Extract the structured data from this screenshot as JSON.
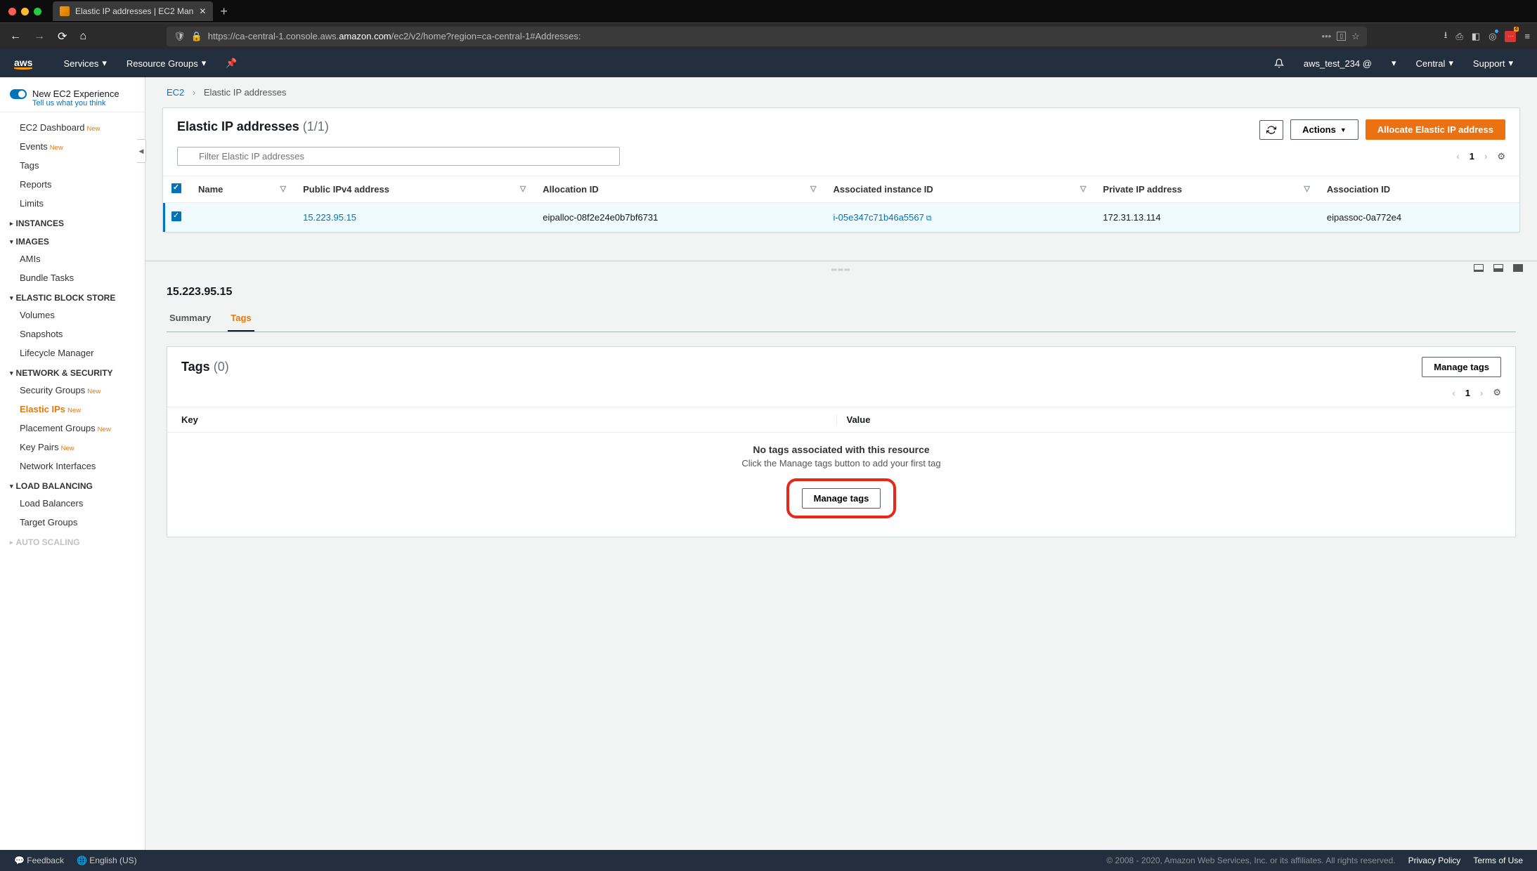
{
  "browser": {
    "tab_title": "Elastic IP addresses | EC2 Man",
    "url_prefix": "https://ca-central-1.console.aws.",
    "url_bold": "amazon.com",
    "url_suffix": "/ec2/v2/home?region=ca-central-1#Addresses:"
  },
  "header": {
    "logo": "aws",
    "services": "Services",
    "resource_groups": "Resource Groups",
    "user": "aws_test_234 @",
    "region": "Central",
    "support": "Support"
  },
  "sidebar": {
    "toggle_label": "New EC2 Experience",
    "toggle_sub": "Tell us what you think",
    "items_top": [
      {
        "label": "EC2 Dashboard",
        "new": true
      },
      {
        "label": "Events",
        "new": true
      },
      {
        "label": "Tags",
        "new": false
      },
      {
        "label": "Reports",
        "new": false
      },
      {
        "label": "Limits",
        "new": false
      }
    ],
    "sec_instances": "INSTANCES",
    "sec_images": "IMAGES",
    "images_items": [
      {
        "label": "AMIs"
      },
      {
        "label": "Bundle Tasks"
      }
    ],
    "sec_ebs": "ELASTIC BLOCK STORE",
    "ebs_items": [
      {
        "label": "Volumes"
      },
      {
        "label": "Snapshots"
      },
      {
        "label": "Lifecycle Manager"
      }
    ],
    "sec_net": "NETWORK & SECURITY",
    "net_items": [
      {
        "label": "Security Groups",
        "new": true,
        "active": false
      },
      {
        "label": "Elastic IPs",
        "new": true,
        "active": true
      },
      {
        "label": "Placement Groups",
        "new": true,
        "active": false
      },
      {
        "label": "Key Pairs",
        "new": true,
        "active": false
      },
      {
        "label": "Network Interfaces",
        "new": false,
        "active": false
      }
    ],
    "sec_lb": "LOAD BALANCING",
    "lb_items": [
      {
        "label": "Load Balancers"
      },
      {
        "label": "Target Groups"
      }
    ],
    "sec_auto": "AUTO SCALING"
  },
  "breadcrumb": {
    "root": "EC2",
    "current": "Elastic IP addresses"
  },
  "eip_panel": {
    "title": "Elastic IP addresses",
    "count": "(1/1)",
    "filter_placeholder": "Filter Elastic IP addresses",
    "actions": "Actions",
    "allocate": "Allocate Elastic IP address",
    "page": "1",
    "cols": {
      "name": "Name",
      "public_ip": "Public IPv4 address",
      "alloc_id": "Allocation ID",
      "assoc_inst": "Associated instance ID",
      "priv_ip": "Private IP address",
      "assoc_id": "Association ID"
    },
    "row": {
      "name": "",
      "public_ip": "15.223.95.15",
      "alloc_id": "eipalloc-08f2e24e0b7bf6731",
      "assoc_inst": "i-05e347c71b46a5567",
      "priv_ip": "172.31.13.114",
      "assoc_id": "eipassoc-0a772e4"
    }
  },
  "detail": {
    "title": "15.223.95.15",
    "tab_summary": "Summary",
    "tab_tags": "Tags",
    "tags_title": "Tags",
    "tags_count": "(0)",
    "manage_tags": "Manage tags",
    "page": "1",
    "col_key": "Key",
    "col_value": "Value",
    "empty_strong": "No tags associated with this resource",
    "empty_sub": "Click the Manage tags button to add your first tag"
  },
  "footer": {
    "feedback": "Feedback",
    "lang": "English (US)",
    "copyright": "© 2008 - 2020, Amazon Web Services, Inc. or its affiliates. All rights reserved.",
    "privacy": "Privacy Policy",
    "terms": "Terms of Use"
  }
}
